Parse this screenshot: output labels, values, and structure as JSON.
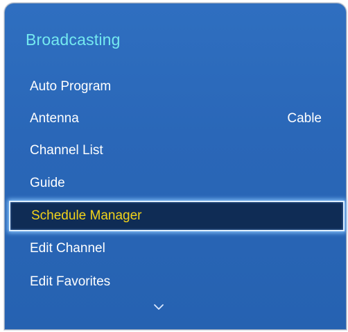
{
  "panel": {
    "title": "Broadcasting"
  },
  "menu": {
    "items": [
      {
        "label": "Auto Program",
        "value": ""
      },
      {
        "label": "Antenna",
        "value": "Cable"
      },
      {
        "label": "Channel List",
        "value": ""
      },
      {
        "label": "Guide",
        "value": ""
      },
      {
        "label": "Schedule Manager",
        "value": "",
        "selected": true
      },
      {
        "label": "Edit Channel",
        "value": ""
      },
      {
        "label": "Edit Favorites",
        "value": ""
      }
    ]
  },
  "icons": {
    "scroll_down": "chevron-down-icon"
  },
  "colors": {
    "panel_bg": "#2a67b8",
    "title": "#74e9f0",
    "item_text": "#ffffff",
    "selected_bg": "#0f2c55",
    "selected_text": "#f2d31a",
    "selected_glow": "#8cc8ff"
  }
}
